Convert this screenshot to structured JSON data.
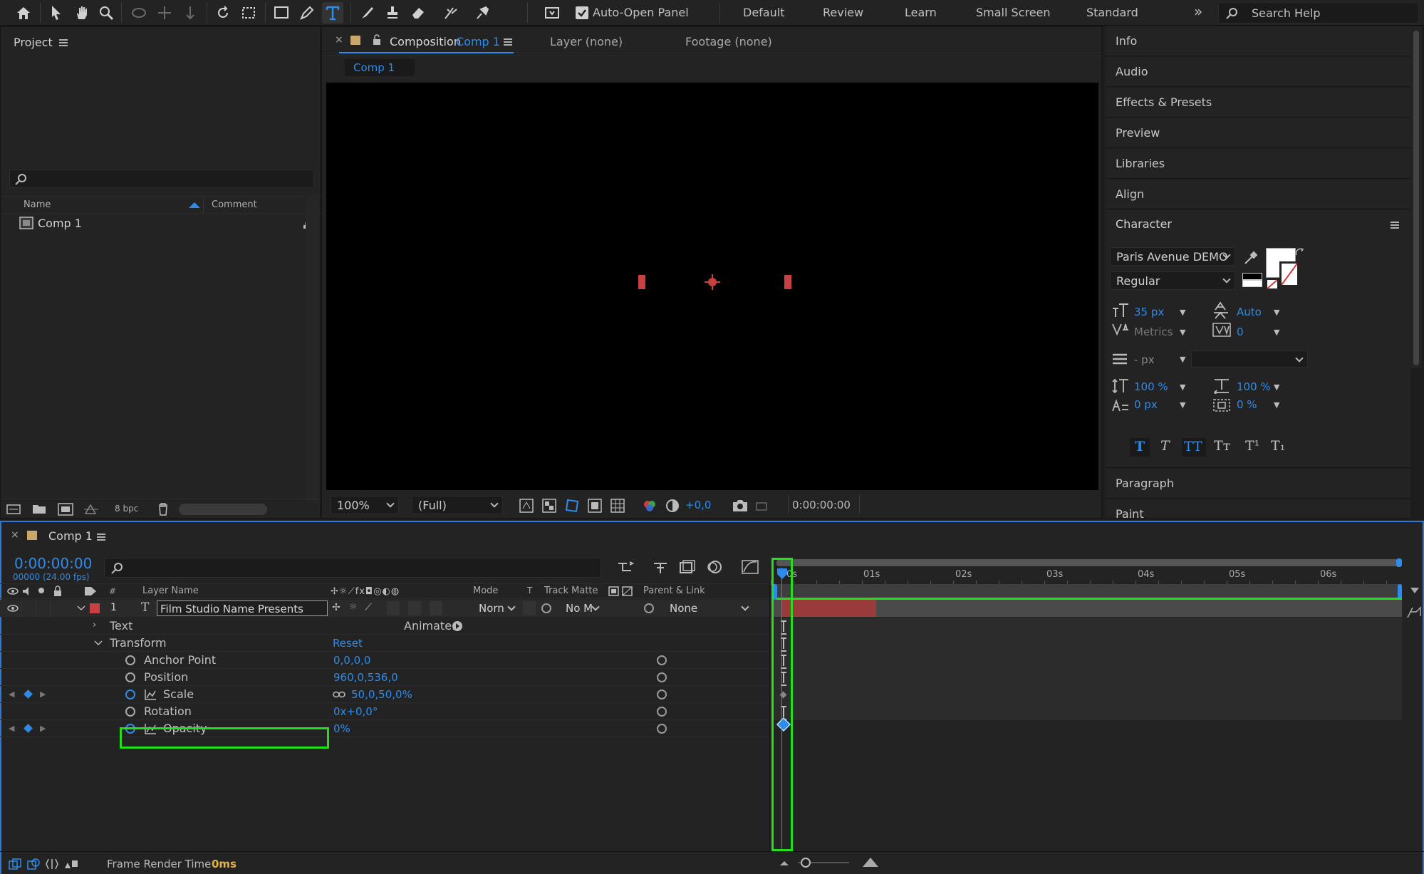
{
  "toolbar": {
    "auto_open_panel": "Auto-Open Panel",
    "workspaces": [
      "Default",
      "Review",
      "Learn",
      "Small Screen",
      "Standard"
    ],
    "search_placeholder": "Search Help"
  },
  "project": {
    "title": "Project",
    "columns": {
      "name": "Name",
      "comment": "Comment"
    },
    "items": [
      {
        "name": "Comp 1"
      }
    ],
    "bpc": "8 bpc"
  },
  "composition": {
    "tab_prefix": "Composition",
    "tab_name": "Comp 1",
    "layer_tab": "Layer (none)",
    "footage_tab": "Footage (none)",
    "subtab": "Comp 1",
    "zoom": "100%",
    "resolution": "(Full)",
    "exposure": "+0,0",
    "timecode": "0:00:00:00"
  },
  "right_panels": {
    "items": [
      "Info",
      "Audio",
      "Effects & Presets",
      "Preview",
      "Libraries",
      "Align"
    ],
    "character_title": "Character",
    "paragraph": "Paragraph",
    "paint": "Paint"
  },
  "character": {
    "font": "Paris Avenue DEMO",
    "style": "Regular",
    "size": "35 px",
    "leading": "Auto",
    "kerning": "Metrics",
    "tracking": "0",
    "stroke": "- px",
    "vscale": "100 %",
    "hscale": "100 %",
    "baseline": "0 px",
    "tsume": "0 %"
  },
  "timeline": {
    "comp_tab": "Comp 1",
    "timecode": "0:00:00:00",
    "frames": "00000 (24.00 fps)",
    "columns": {
      "hash": "#",
      "layer_name": "Layer Name",
      "mode": "Mode",
      "t": "T",
      "track_matte": "Track Matte",
      "parent": "Parent & Link"
    },
    "ruler": [
      "01s",
      "02s",
      "03s",
      "04s",
      "05s",
      "06s"
    ],
    "layer": {
      "index": "1",
      "name": "Film Studio Name Presents",
      "mode": "Norn",
      "matte": "No M",
      "parent": "None"
    },
    "text_group": "Text",
    "animate": "Animate:",
    "transform_group": "Transform",
    "reset": "Reset",
    "properties": [
      {
        "name": "Anchor Point",
        "value": "0,0,0,0"
      },
      {
        "name": "Position",
        "value": "960,0,536,0"
      },
      {
        "name": "Scale",
        "value": "50,0,50,0%"
      },
      {
        "name": "Rotation",
        "value": "0x+0,0°"
      },
      {
        "name": "Opacity",
        "value": "0%"
      }
    ],
    "frame_render_label": "Frame Render Time",
    "frame_render_value": "0ms"
  },
  "colors": {
    "accent": "#2d8ceb",
    "highlight": "#22e01a",
    "label_red": "#c8403f"
  }
}
